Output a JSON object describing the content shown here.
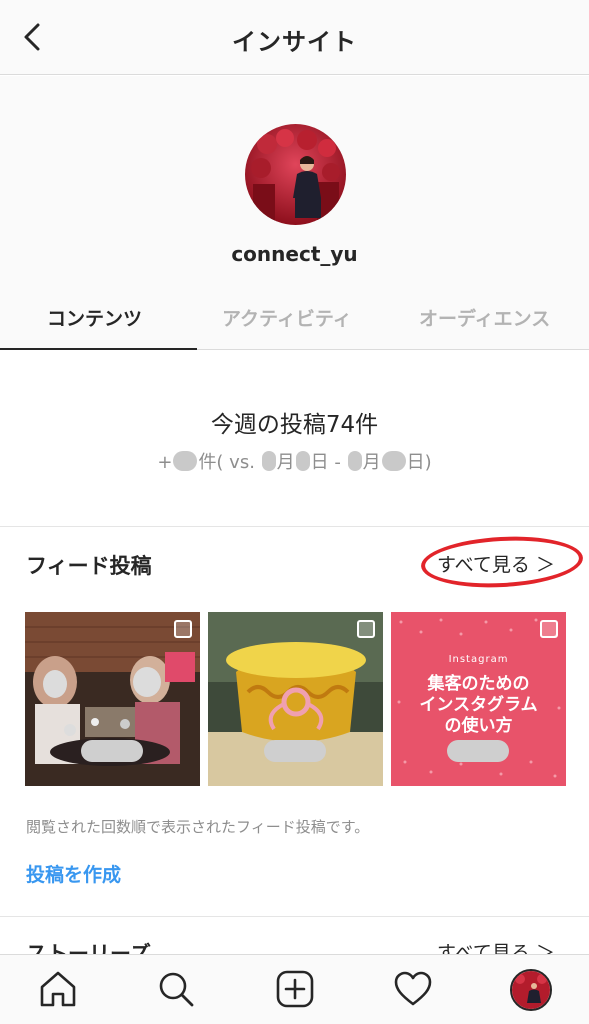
{
  "header": {
    "title": "インサイト",
    "back_icon": "chevron-left-icon"
  },
  "profile": {
    "username": "connect_yu"
  },
  "tabs": [
    {
      "label": "コンテンツ",
      "active": true
    },
    {
      "label": "アクティビティ",
      "active": false
    },
    {
      "label": "オーディエンス",
      "active": false
    }
  ],
  "summary": {
    "title": "今週の投稿74件",
    "sub_prefix": "+",
    "sub_count_unit": "件( vs. ",
    "sub_month1": "月",
    "sub_day1": "日 - ",
    "sub_month2": "月",
    "sub_day2": "日)"
  },
  "feed": {
    "title": "フィード投稿",
    "see_all": "すべて見る ＞",
    "note": "閲覧された回数順で表示されたフィード投稿です。",
    "create_post": "投稿を作成",
    "thumbnails": [
      {
        "kind": "photo-party"
      },
      {
        "kind": "photo-gift"
      },
      {
        "kind": "graphic",
        "small_text": "Instagram",
        "main_text_lines": [
          "集客のための",
          "インスタグラム",
          "の使い方"
        ]
      }
    ]
  },
  "stories": {
    "title": "ストーリーズ",
    "see_all": "すべて見る ＞"
  },
  "bottom_nav": {
    "items": [
      "home-icon",
      "search-icon",
      "add-post-icon",
      "heart-icon",
      "profile-avatar"
    ]
  },
  "colors": {
    "accent_link": "#3897f0",
    "highlight_circle": "#e2242a",
    "text_primary": "#262626",
    "text_muted": "#8e8e8e"
  }
}
